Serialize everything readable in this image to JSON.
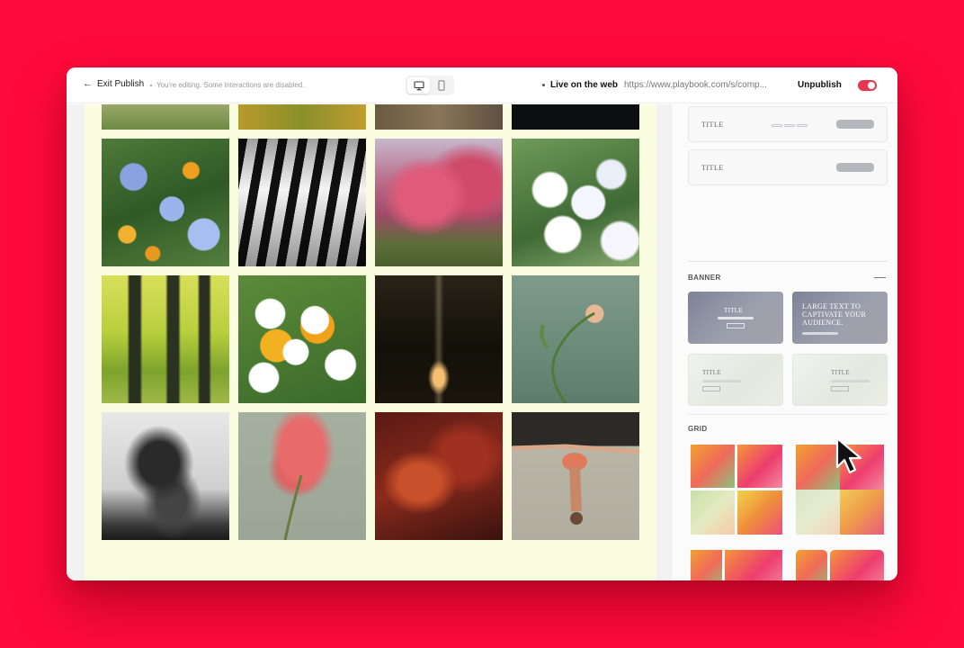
{
  "topbar": {
    "exit_label": "Exit Publish",
    "editing_note": "You're editing. Some interactions are disabled.",
    "live_label": "Live on the web",
    "url": "https://www.playbook.com/s/comp...",
    "unpublish_label": "Unpublish",
    "publish_toggle_on": true,
    "device_selected": "desktop"
  },
  "panel": {
    "nav_cards": [
      {
        "title": "TITLE",
        "has_links": true
      },
      {
        "title": "TITLE",
        "has_links": false
      }
    ],
    "banner_section": {
      "title": "BANNER",
      "templates": [
        {
          "title": "TITLE"
        },
        {
          "title": "LARGE TEXT TO CAPTIVATE YOUR AUDIENCE."
        },
        {
          "title": "TITLE"
        },
        {
          "title": "TITLE"
        }
      ]
    },
    "grid_section": {
      "title": "GRID"
    }
  },
  "colors": {
    "background": "#ff0a3c",
    "page_bg": "#fbfde0",
    "toggle_on": "#e8384f"
  }
}
